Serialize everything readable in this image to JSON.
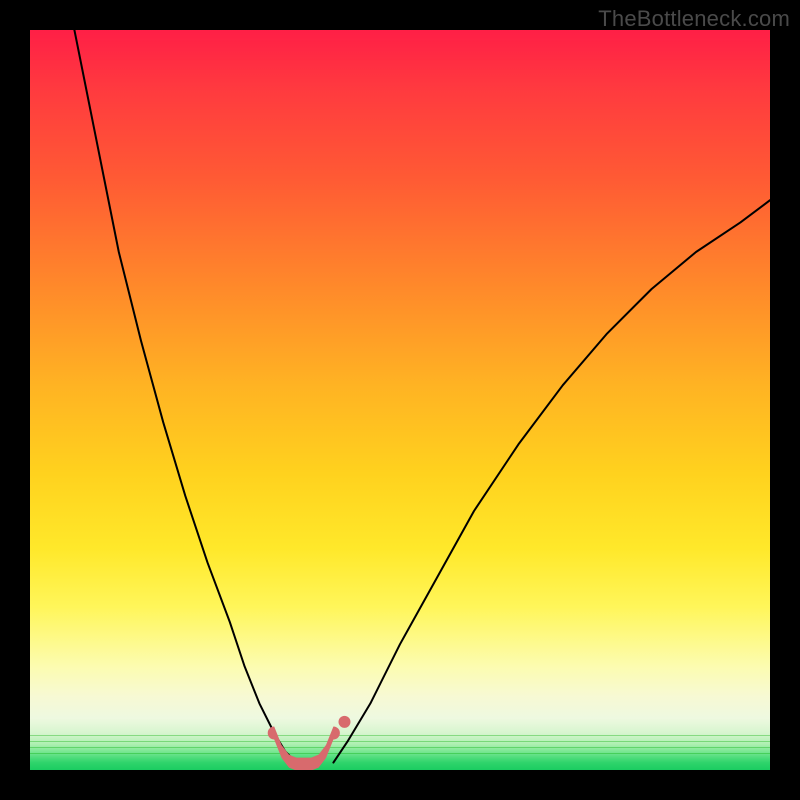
{
  "watermark": "TheBottleneck.com",
  "colors": {
    "curve": "#000000",
    "marker": "#d86a6d",
    "background_top": "#ff1f46",
    "background_bottom": "#1bcd61",
    "frame": "#000000"
  },
  "chart_data": {
    "type": "line",
    "title": "",
    "xlabel": "",
    "ylabel": "",
    "xlim": [
      0,
      100
    ],
    "ylim": [
      0,
      100
    ],
    "grid": false,
    "legend": false,
    "series": [
      {
        "name": "left-descending-curve",
        "x": [
          6,
          8,
          10,
          12,
          15,
          18,
          21,
          24,
          27,
          29,
          31,
          33,
          34.5,
          36
        ],
        "y": [
          100,
          90,
          80,
          70,
          58,
          47,
          37,
          28,
          20,
          14,
          9,
          5,
          2.5,
          1
        ]
      },
      {
        "name": "right-ascending-curve",
        "x": [
          41,
          43,
          46,
          50,
          55,
          60,
          66,
          72,
          78,
          84,
          90,
          96,
          100
        ],
        "y": [
          1,
          4,
          9,
          17,
          26,
          35,
          44,
          52,
          59,
          65,
          70,
          74,
          77
        ]
      }
    ],
    "markers": {
      "name": "valley-marker-band",
      "shape": "rounded-u",
      "color": "#d86a6d",
      "points_x": [
        33,
        34,
        35,
        36,
        37,
        38,
        39,
        40,
        41
      ],
      "points_y": [
        5,
        2.5,
        1.2,
        0.8,
        0.8,
        0.8,
        1.2,
        2.5,
        5
      ],
      "extra_dot": {
        "x": 42.5,
        "y": 6.5
      }
    }
  }
}
